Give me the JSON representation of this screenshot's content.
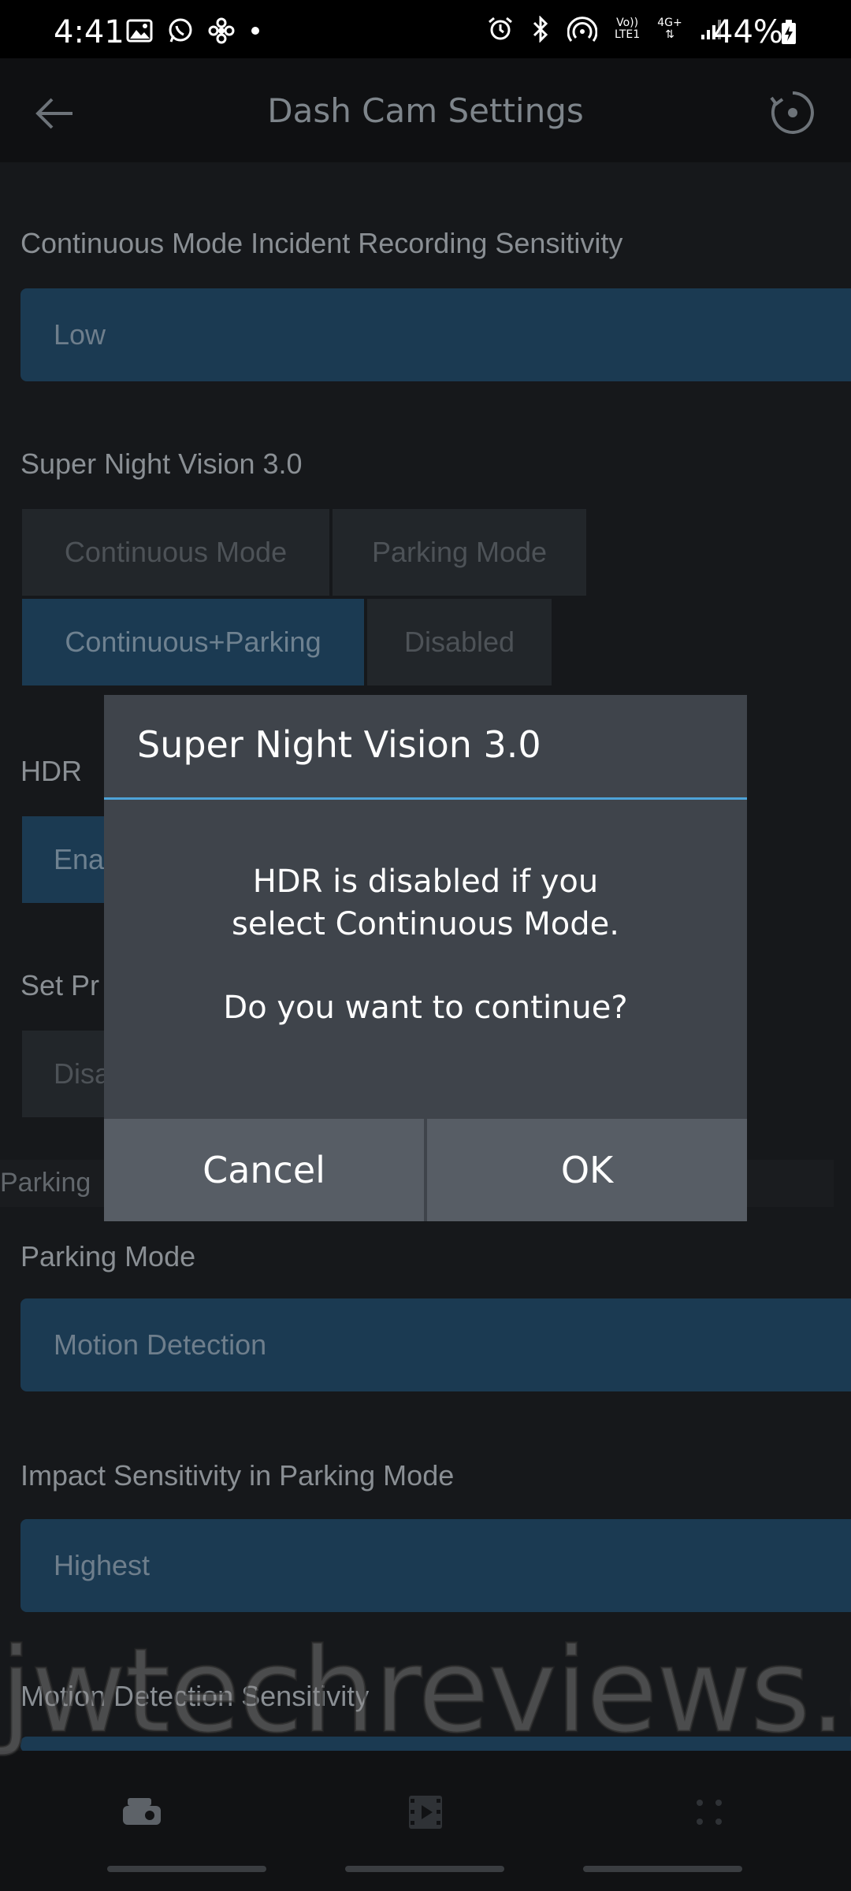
{
  "status_bar": {
    "time": "4:41",
    "battery": "44%",
    "left_icons": [
      "gallery-icon",
      "whatsapp-icon",
      "fan-icon",
      "dot-icon"
    ],
    "right_icons": [
      "alarm-icon",
      "bluetooth-icon",
      "hotspot-icon",
      "volte-icon",
      "4g-icon",
      "signal-icon"
    ],
    "volte_label": "Vo))",
    "lte_label": "LTE1",
    "net_label": "4G+"
  },
  "app_bar": {
    "title": "Dash Cam Settings"
  },
  "settings": {
    "incident_sensitivity": {
      "label": "Continuous Mode Incident Recording Sensitivity",
      "value": "Low"
    },
    "super_night_vision": {
      "label": "Super Night Vision 3.0",
      "options": [
        "Continuous Mode",
        "Parking Mode",
        "Continuous+Parking",
        "Disabled"
      ],
      "selected": "Continuous+Parking"
    },
    "hdr": {
      "label": "HDR",
      "value_partial": "Ena"
    },
    "set_pr": {
      "label_partial": "Set Pr",
      "value_partial": "Disa"
    },
    "parking_banner_partial": "Parking",
    "parking_mode": {
      "label": "Parking Mode",
      "value": "Motion Detection"
    },
    "impact_sensitivity": {
      "label": "Impact Sensitivity in Parking Mode",
      "value": "Highest"
    },
    "motion_detection": {
      "label": "Motion Detection Sensitivity"
    }
  },
  "dialog": {
    "title": "Super Night Vision 3.0",
    "message_line1": "HDR is disabled if you",
    "message_line2": "select Continuous Mode.",
    "message_line3": "Do you want to continue?",
    "cancel_label": "Cancel",
    "ok_label": "OK"
  },
  "watermark": "jwtechreviews.com",
  "colors": {
    "accent": "#4ea3d8",
    "dialog_bg": "#3f444b",
    "dialog_button_bg": "#575d65",
    "selected_segment": "#1b3a52"
  }
}
